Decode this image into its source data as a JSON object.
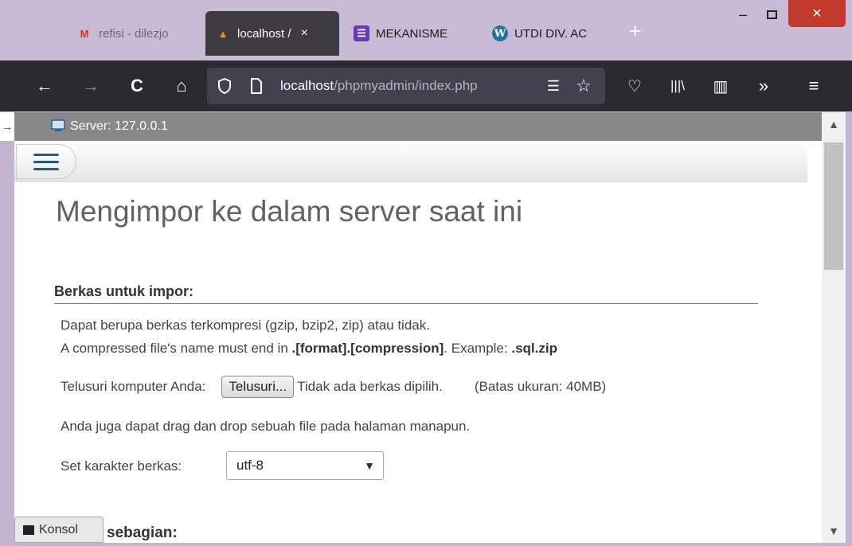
{
  "tabs": [
    {
      "title": "refisi - dilezjo",
      "icon": "gmail-icon",
      "active": false
    },
    {
      "title": "localhost / ",
      "icon": "phpmyadmin-icon",
      "active": true,
      "close": "×"
    },
    {
      "title": "MEKANISME",
      "icon": "forms-icon",
      "active": false
    },
    {
      "title": "UTDI DIV. AC",
      "icon": "wordpress-icon",
      "active": false
    }
  ],
  "newtab": "+",
  "window_controls": {
    "minimize": "–",
    "maximize": "",
    "close": "×"
  },
  "nav": {
    "back": "←",
    "forward": "→",
    "reload": "C",
    "home": "⌂",
    "url_host": "localhost",
    "url_path": "/phpmyadmin/index.php",
    "reader": "☰",
    "bookmark": "☆",
    "pocket": "♡",
    "library": "|||\\",
    "sidebar": "▥",
    "overflow": "»",
    "menu": "≡"
  },
  "server": {
    "arrow": "→",
    "label": "Server: 127.0.0.1"
  },
  "main": {
    "title": "Mengimpor ke dalam server saat ini",
    "section_heading": "Berkas untuk impor:",
    "desc1": "Dapat berupa berkas terkompresi (gzip, bzip2, zip) atau tidak.",
    "desc2_prefix": "A compressed file's name must end in ",
    "desc2_bold": ".[format].[compression]",
    "desc2_mid": ". Example: ",
    "desc2_bold2": ".sql.zip",
    "browse_label": "Telusuri komputer Anda:",
    "browse_button": "Telusuri...",
    "no_file": "Tidak ada berkas dipilih.",
    "limit": "(Batas ukuran: 40MB)",
    "dragdrop": "Anda juga dapat drag dan drop sebuah file pada halaman manapun.",
    "charset_label": "Set karakter berkas:",
    "charset_value": "utf-8",
    "partial_heading": "sebagian:"
  },
  "console": {
    "label": "Konsol"
  }
}
